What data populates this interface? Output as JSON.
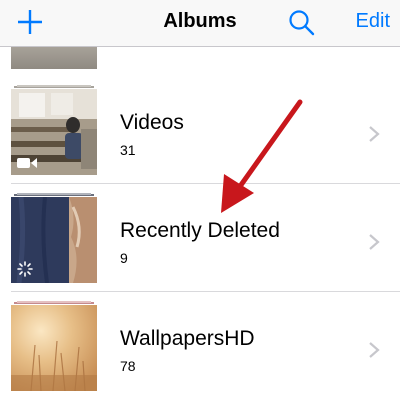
{
  "navbar": {
    "title": "Albums",
    "edit_label": "Edit",
    "add_icon": "plus-icon",
    "search_icon": "search-icon"
  },
  "albums": [
    {
      "name": "Videos",
      "count": "31",
      "badge_icon": "video-camera-icon"
    },
    {
      "name": "Recently Deleted",
      "count": "9",
      "badge_icon": "spinner-icon"
    },
    {
      "name": "WallpapersHD",
      "count": "78"
    }
  ],
  "colors": {
    "accent": "#007aff",
    "annotation_arrow": "#c8171c",
    "chevron": "#c7c7cc"
  }
}
